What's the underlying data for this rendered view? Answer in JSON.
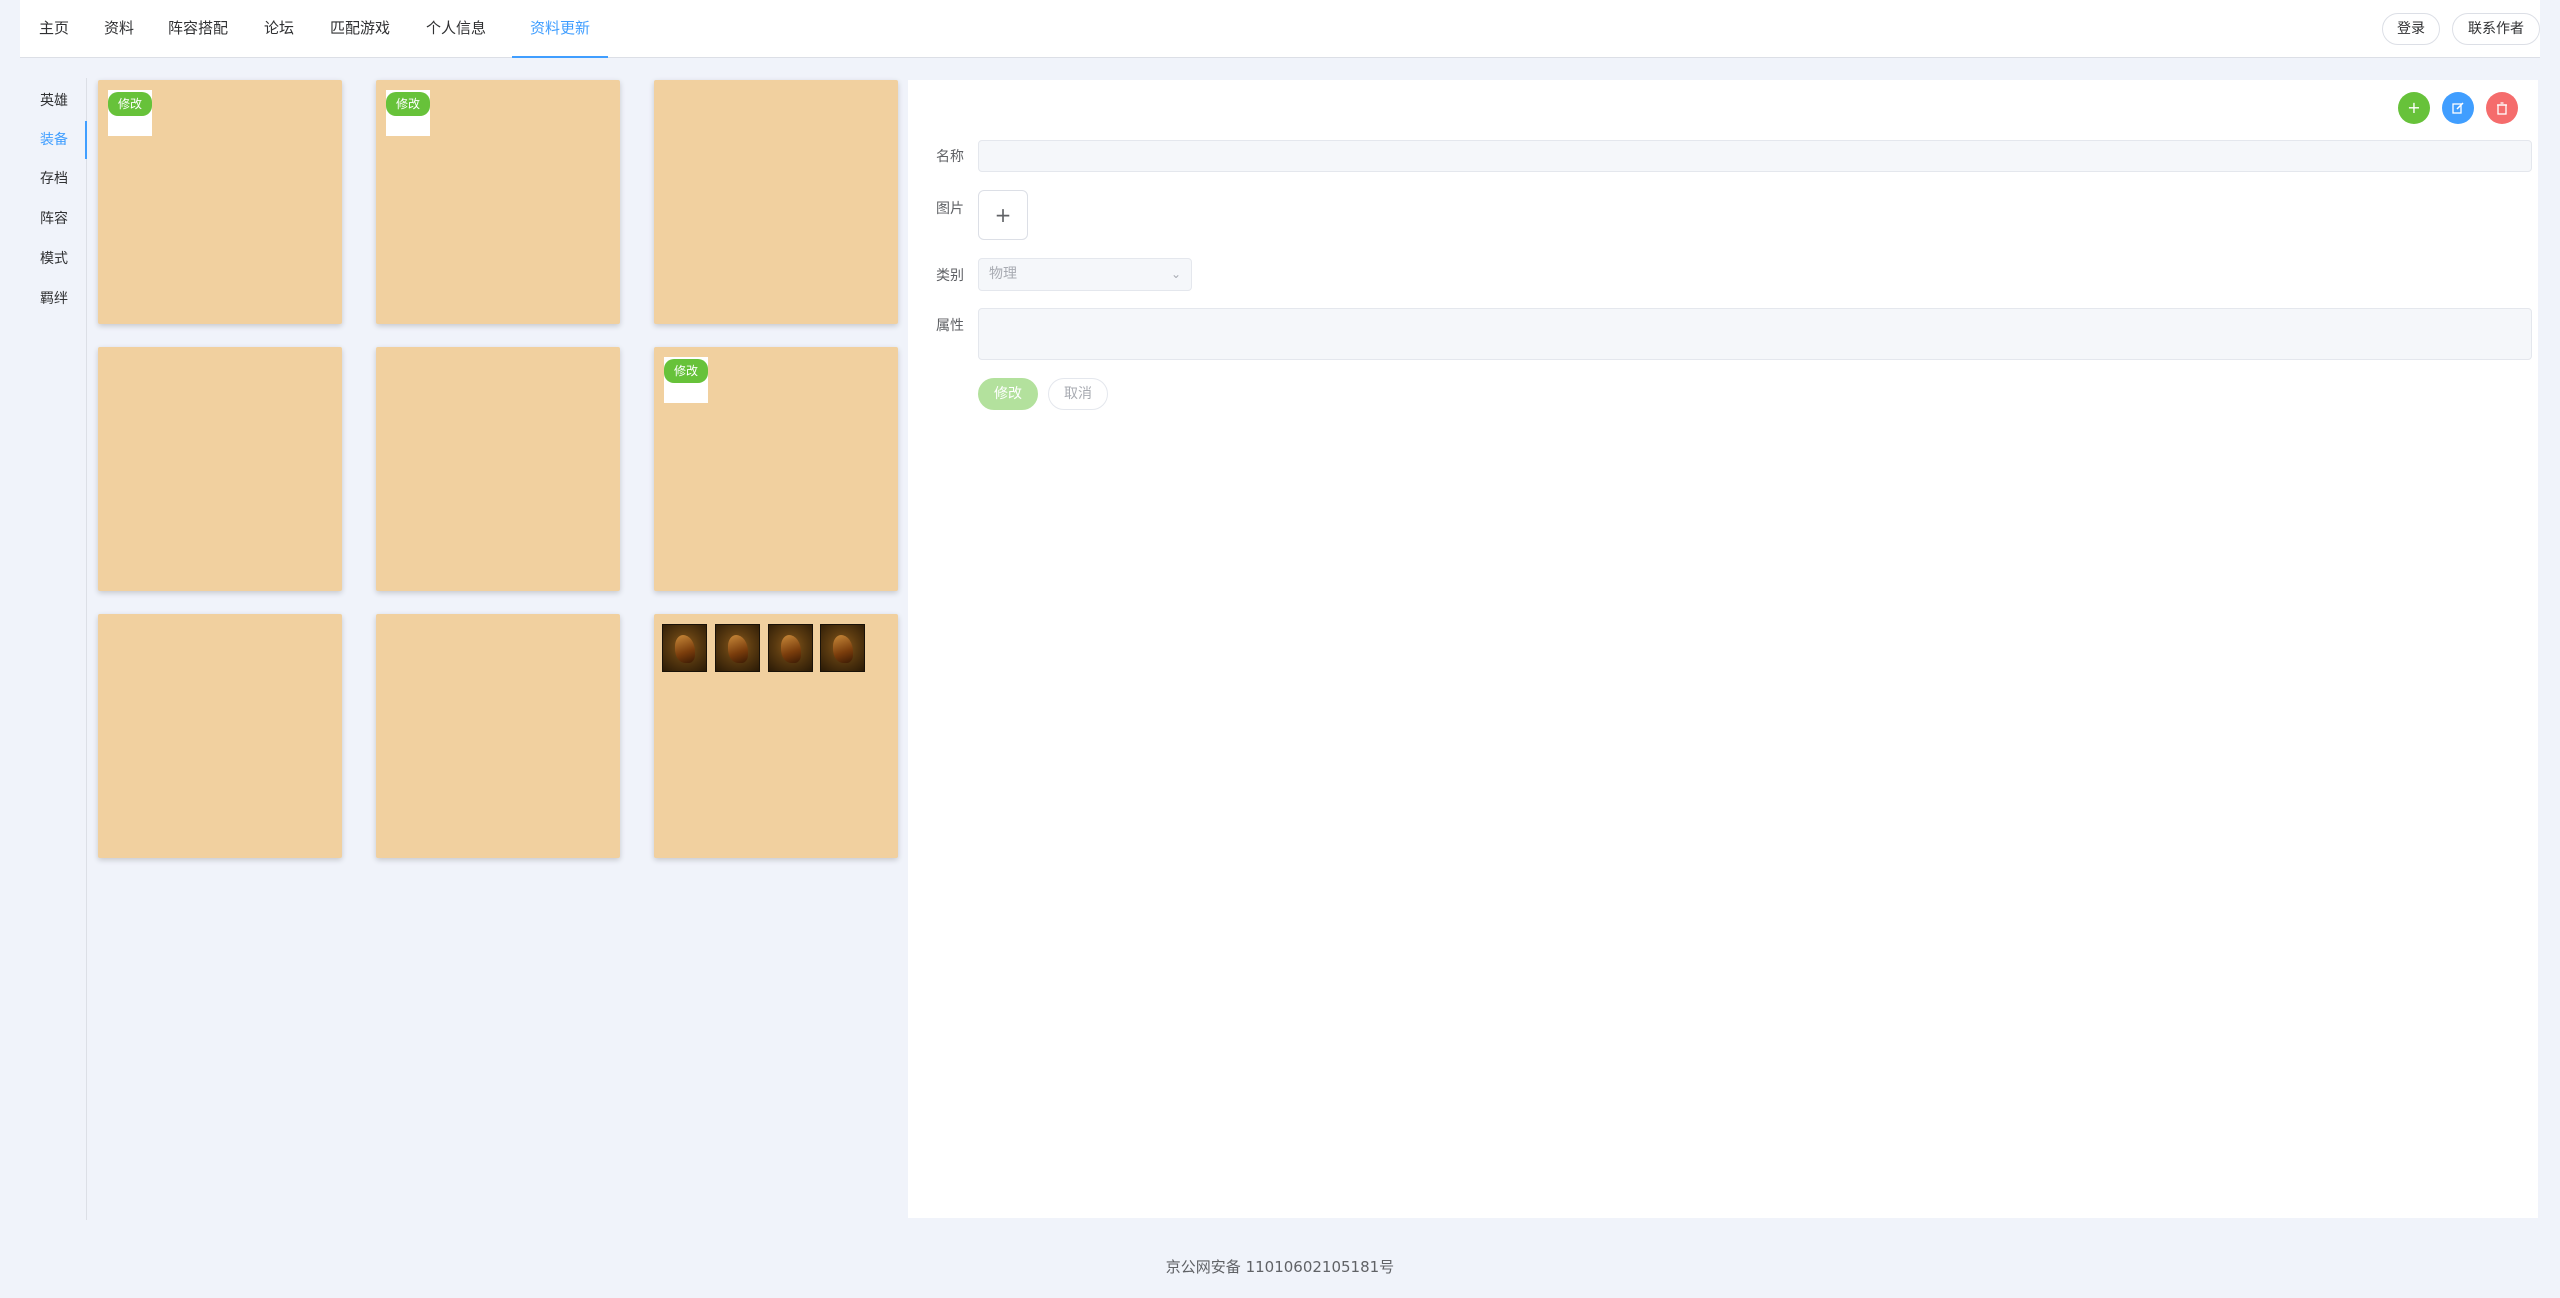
{
  "nav": {
    "tabs": [
      "主页",
      "资料",
      "阵容搭配",
      "论坛",
      "匹配游戏",
      "个人信息",
      "资料更新"
    ],
    "active_tab": "资料更新",
    "login_label": "登录",
    "contact_label": "联系作者"
  },
  "sidebar": {
    "items": [
      "英雄",
      "装备",
      "存档",
      "阵容",
      "模式",
      "羁绊"
    ],
    "active_item": "装备"
  },
  "grid": {
    "badge_label": "修改",
    "cards": [
      {
        "has_badge": true
      },
      {
        "has_badge": true
      },
      {
        "has_badge": false
      },
      {
        "has_badge": false
      },
      {
        "has_badge": false
      },
      {
        "has_badge": true
      },
      {
        "has_badge": false
      },
      {
        "has_badge": false
      },
      {
        "has_badge": false,
        "icon_count": 4
      }
    ]
  },
  "form": {
    "name_label": "名称",
    "name_value": "",
    "image_label": "图片",
    "upload_icon": "+",
    "category_label": "类别",
    "category_value": "物理",
    "attr_label": "属性",
    "attr_value": "",
    "submit_label": "修改",
    "cancel_label": "取消"
  },
  "actions": {
    "add_color": "#67c23a",
    "edit_color": "#409eff",
    "delete_color": "#f56c6c"
  },
  "footer": {
    "text": "京公网安备 11010602105181号"
  },
  "colors": {
    "accent": "#409eff",
    "card_bg": "#f1d09f",
    "badge": "#67c23a",
    "page_bg": "#f0f3fa"
  }
}
